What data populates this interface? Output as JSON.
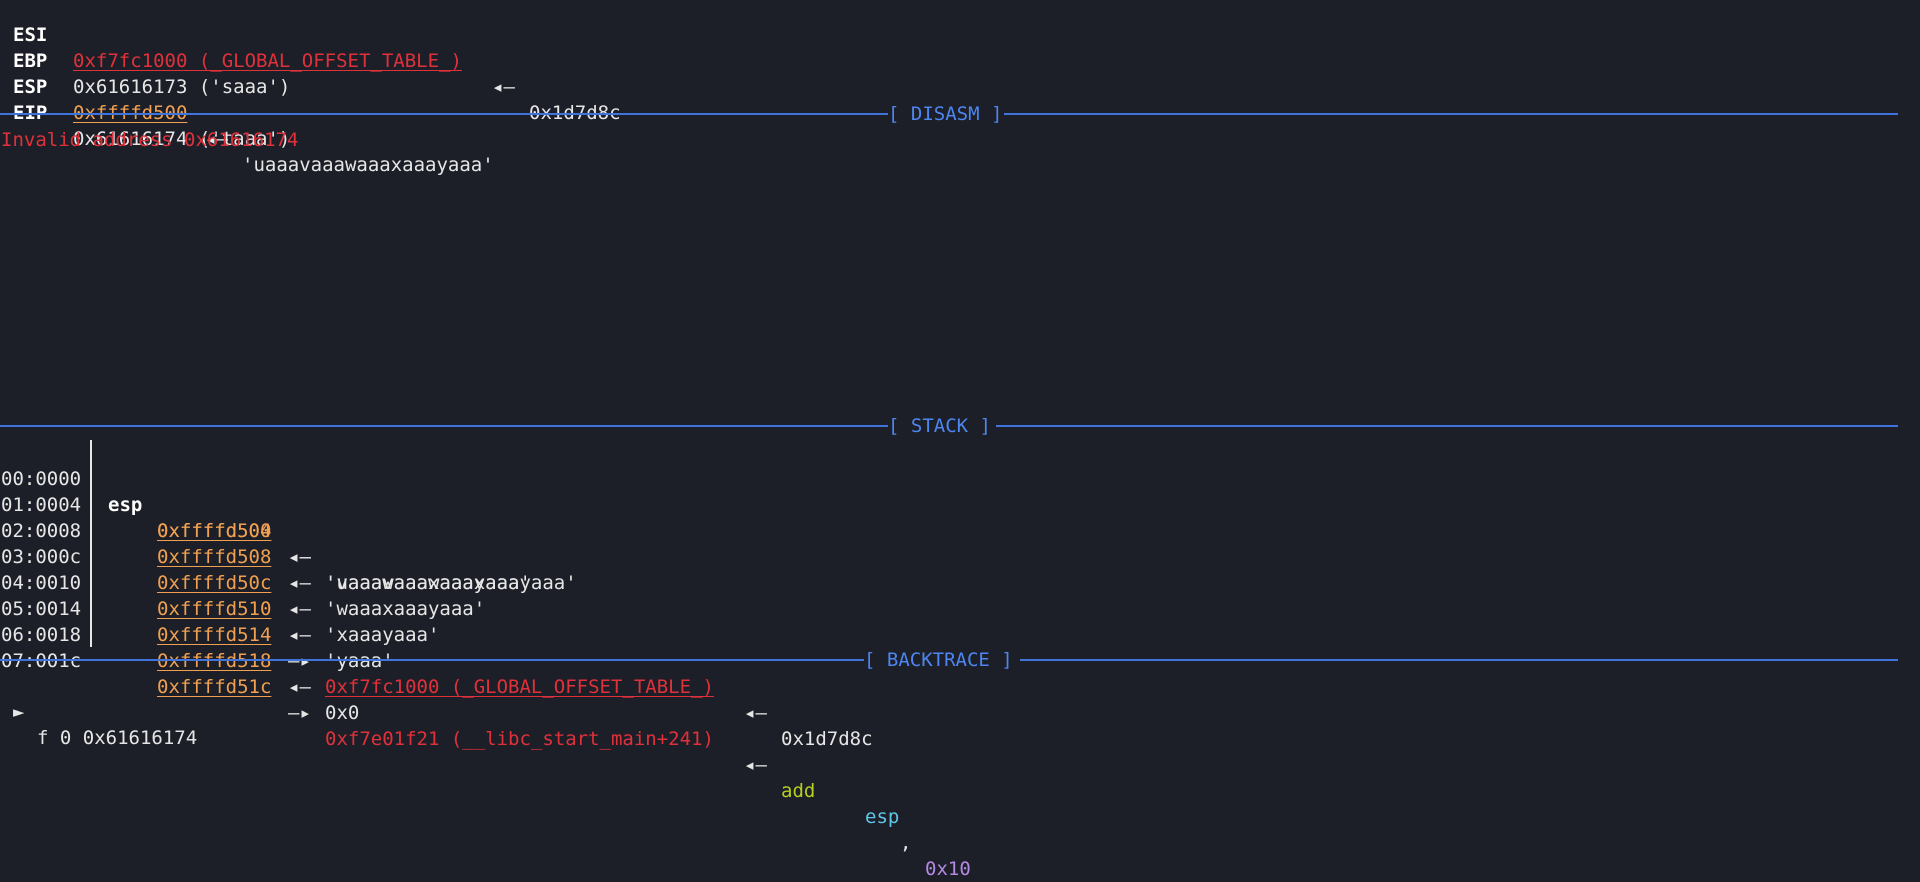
{
  "registers": [
    {
      "name": "ESI",
      "addr": "0xf7fc1000 (_GLOBAL_OFFSET_TABLE_)",
      "arrow": "◂—",
      "value": "0x1d7d8c"
    },
    {
      "name": "EBP",
      "value": "0x61616173 ('saaa')"
    },
    {
      "name": "ESP",
      "addr": "0xffffd500",
      "arrow": "◂—",
      "value": "'uaaavaaawaaaxaaayaaa'"
    },
    {
      "name": "EIP",
      "value": "0x61616174 ('taaa')"
    }
  ],
  "sections": {
    "disasm": "[ DISASM ]",
    "stack": "[ STACK ]",
    "backtrace": "[ BACKTRACE ]"
  },
  "disasm_message": "Invalid address 0x61616174",
  "stack": [
    {
      "offset": "00:0000",
      "label": "esp",
      "addr": "0xffffd500",
      "arrow": "◂—",
      "value": "'uaaavaaawaaaxaaayaaa'"
    },
    {
      "offset": "01:0004",
      "label": "",
      "addr": "0xffffd504",
      "arrow": "◂—",
      "value": "'vaaawaaaxaaayaaa'"
    },
    {
      "offset": "02:0008",
      "label": "",
      "addr": "0xffffd508",
      "arrow": "◂—",
      "value": "'waaaxaaayaaa'"
    },
    {
      "offset": "03:000c",
      "label": "",
      "addr": "0xffffd50c",
      "arrow": "◂—",
      "value": "'xaaayaaa'"
    },
    {
      "offset": "04:0010",
      "label": "",
      "addr": "0xffffd510",
      "arrow": "◂—",
      "value": "'yaaa'"
    },
    {
      "offset": "05:0014",
      "label": "",
      "addr": "0xffffd514",
      "arrow": "—▸",
      "target": "0xf7fc1000 (_GLOBAL_OFFSET_TABLE_)",
      "arrow2": "◂—",
      "value": "0x1d7d8c"
    },
    {
      "offset": "06:0018",
      "label": "",
      "addr": "0xffffd518",
      "arrow": "◂—",
      "value": "0x0"
    },
    {
      "offset": "07:001c",
      "label": "",
      "addr": "0xffffd51c",
      "arrow": "—▸",
      "target": "0xf7e01f21 (__libc_start_main+241)",
      "arrow2": "◂—",
      "mnemonic": "add",
      "operand_reg": "esp",
      "operand_sep": ",",
      "operand_imm": "0x10"
    }
  ],
  "backtrace": [
    {
      "marker": "►",
      "text": "f 0 0x61616174"
    }
  ],
  "colors": {
    "background": "#1c1f27",
    "separator": "#3f74dd",
    "address_stack": "#f0a050",
    "address_data": "#e0313b",
    "mnemonic": "#b7cf1e",
    "register": "#5fc6e8",
    "immediate": "#b489e6"
  }
}
